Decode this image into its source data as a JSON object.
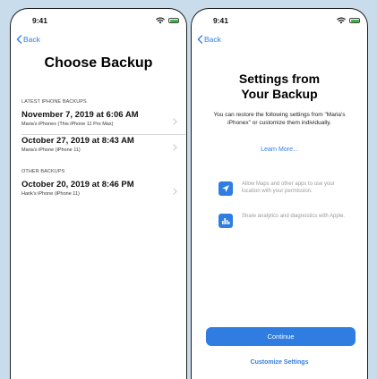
{
  "colors": {
    "accent": "#2f7de1",
    "battery": "#3bb54a",
    "background": "#c9dcec"
  },
  "left_screen": {
    "status": {
      "time": "9:41"
    },
    "back_label": "Back",
    "title": "Choose Backup",
    "sections": [
      {
        "header": "LATEST IPHONE BACKUPS",
        "backups": [
          {
            "date": "November 7, 2019 at 6:06 AM",
            "device": "Maria's iPhonex (This iPhone 11 Pro Max)"
          },
          {
            "date": "October 27, 2019 at 8:43 AM",
            "device": "Maria's iPhone (iPhone 11)"
          }
        ]
      },
      {
        "header": "OTHER BACKUPS",
        "backups": [
          {
            "date": "October 20, 2019 at 8:46 PM",
            "device": "Hank's iPhone (iPhone 11)"
          }
        ]
      }
    ]
  },
  "right_screen": {
    "status": {
      "time": "9:41"
    },
    "back_label": "Back",
    "title_line1": "Settings from",
    "title_line2": "Your Backup",
    "description": "You can restore the following settings from \"Maria's iPhonex\" or customize them individually.",
    "learn_more": "Learn More...",
    "permissions": [
      {
        "icon": "location-arrow-icon",
        "text": "Allow Maps and other apps to use your location with your permission."
      },
      {
        "icon": "analytics-chart-icon",
        "text": "Share analytics and diagnostics with Apple."
      }
    ],
    "continue_label": "Continue",
    "customize_label": "Customize Settings"
  }
}
